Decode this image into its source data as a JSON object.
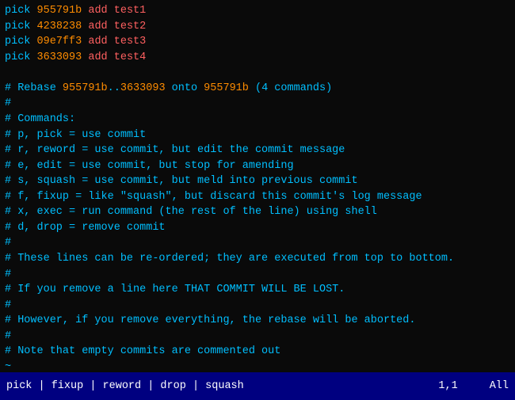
{
  "editor": {
    "lines": [
      {
        "type": "pick-line",
        "keyword": "pick",
        "sha": "955791b",
        "msg": "add test1"
      },
      {
        "type": "pick-line",
        "keyword": "pick",
        "sha": "4238238",
        "msg": "add test2"
      },
      {
        "type": "pick-line",
        "keyword": "pick",
        "sha": "09e7ff3",
        "msg": "add test3"
      },
      {
        "type": "pick-line",
        "keyword": "pick",
        "sha": "3633093",
        "msg": "add test4"
      },
      {
        "type": "blank"
      },
      {
        "type": "comment",
        "text": "# Rebase 955791b..3633093 onto 955791b (4 commands)"
      },
      {
        "type": "comment",
        "text": "#"
      },
      {
        "type": "comment",
        "text": "# Commands:"
      },
      {
        "type": "comment",
        "text": "# p, pick = use commit"
      },
      {
        "type": "comment",
        "text": "# r, reword = use commit, but edit the commit message"
      },
      {
        "type": "comment",
        "text": "# e, edit = use commit, but stop for amending"
      },
      {
        "type": "comment",
        "text": "# s, squash = use commit, but meld into previous commit"
      },
      {
        "type": "comment",
        "text": "# f, fixup = like \"squash\", but discard this commit's log message"
      },
      {
        "type": "comment",
        "text": "# x, exec = run command (the rest of the line) using shell"
      },
      {
        "type": "comment",
        "text": "# d, drop = remove commit"
      },
      {
        "type": "comment",
        "text": "#"
      },
      {
        "type": "comment",
        "text": "# These lines can be re-ordered; they are executed from top to bottom."
      },
      {
        "type": "comment",
        "text": "#"
      },
      {
        "type": "comment",
        "text": "# If you remove a line here THAT COMMIT WILL BE LOST."
      },
      {
        "type": "comment",
        "text": "#"
      },
      {
        "type": "comment",
        "text": "# However, if you remove everything, the rebase will be aborted."
      },
      {
        "type": "comment",
        "text": "#"
      },
      {
        "type": "comment",
        "text": "# Note that empty commits are commented out"
      },
      {
        "type": "tilde"
      },
      {
        "type": "tilde"
      }
    ]
  },
  "statusbar": {
    "commands": "pick | fixup | reword | drop | squash",
    "position": "1,1",
    "scroll": "All"
  }
}
